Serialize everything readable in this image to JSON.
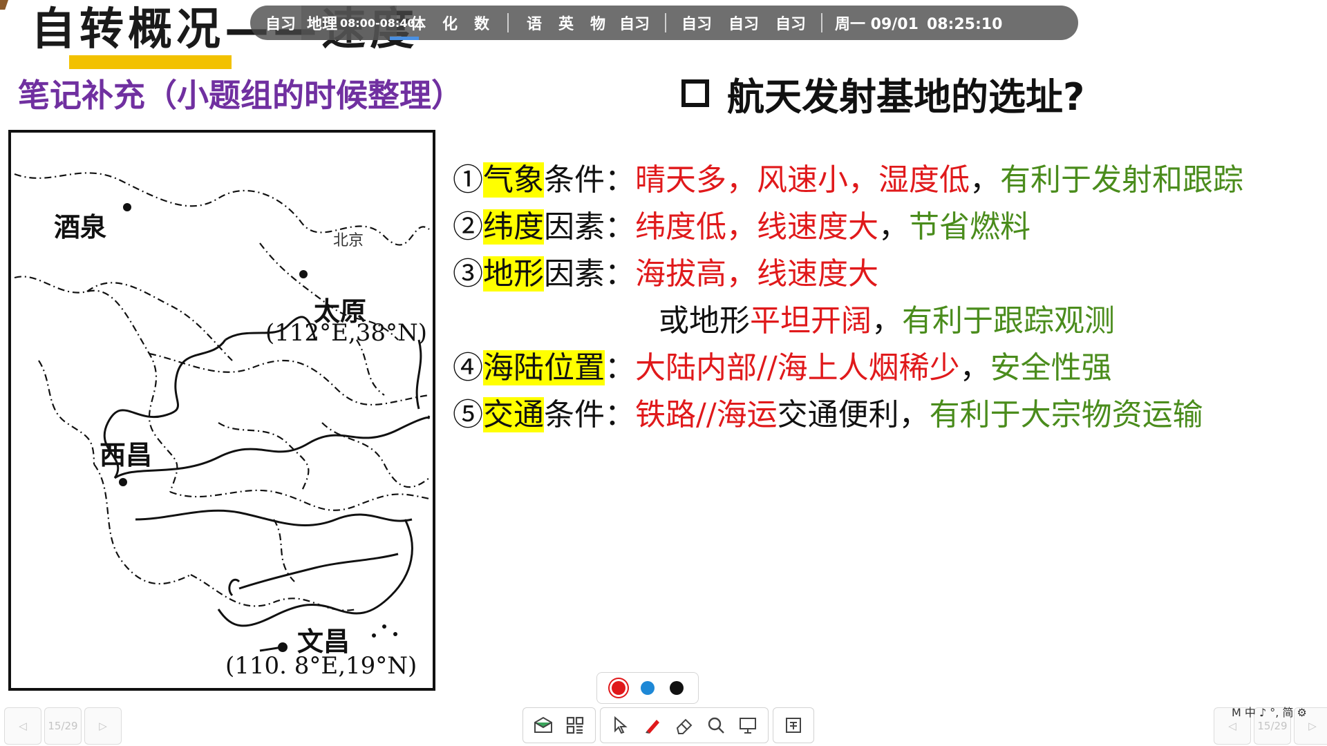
{
  "slide": {
    "title": "自转概况——速度",
    "subtitle": "笔记补充（小题组的时候整理）",
    "question": "航天发射基地的选址?"
  },
  "schedule": {
    "before": [
      "自习"
    ],
    "current": {
      "subject": "地理",
      "time": "08:00-08:40"
    },
    "after1": [
      "体",
      "化",
      "数"
    ],
    "after2": [
      "语",
      "英",
      "物",
      "自习"
    ],
    "after3": [
      "自习",
      "自习",
      "自习"
    ],
    "clock": {
      "date": "周一 09/01",
      "time": "08:25:10"
    }
  },
  "notes": [
    {
      "num": "①",
      "key": "气象",
      "label": "条件：",
      "red": "晴天多，风速小，湿度低",
      "sep": "，",
      "green": "有利于发射和跟踪"
    },
    {
      "num": "②",
      "key": "纬度",
      "label": "因素：",
      "red": "纬度低，线速度大",
      "sep": "，",
      "green": "节省燃料"
    },
    {
      "num": "③",
      "key": "地形",
      "label": "因素：",
      "red": "海拔高，线速度大"
    },
    {
      "prefix": "或地形",
      "red": "平坦开阔",
      "sep": "，",
      "green": "有利于跟踪观测"
    },
    {
      "num": "④",
      "key": "海陆位置",
      "label": "：",
      "red": "大陆内部//海上人烟稀少",
      "sep": "，",
      "green": "安全性强"
    },
    {
      "num": "⑤",
      "key": "交通",
      "label": "条件：",
      "red": "铁路//海运",
      "black": "交通便利，",
      "green": "有利于大宗物资运输"
    }
  ],
  "map": {
    "cities": {
      "jiuquan": "酒泉",
      "beijing": "北京",
      "taiyuan": "太原",
      "taiyuan_coord": "(112°E,38°N)",
      "xichang": "西昌",
      "wenchang": "文昌",
      "wenchang_coord": "(110. 8°E,19°N)"
    }
  },
  "palette": {
    "colors": [
      "#e0191b",
      "#1e88d6",
      "#111111"
    ],
    "selected": "#e0191b"
  },
  "toolbar": {
    "icons": [
      "whiteboard-icon",
      "grid-icon",
      "cursor-icon",
      "pen-icon",
      "eraser-icon",
      "search-icon",
      "screen-icon",
      "export-icon"
    ]
  },
  "pager": {
    "left": "15/29",
    "right": "15/29"
  },
  "ime": "M 中 ♪ °, 简 ⚙"
}
